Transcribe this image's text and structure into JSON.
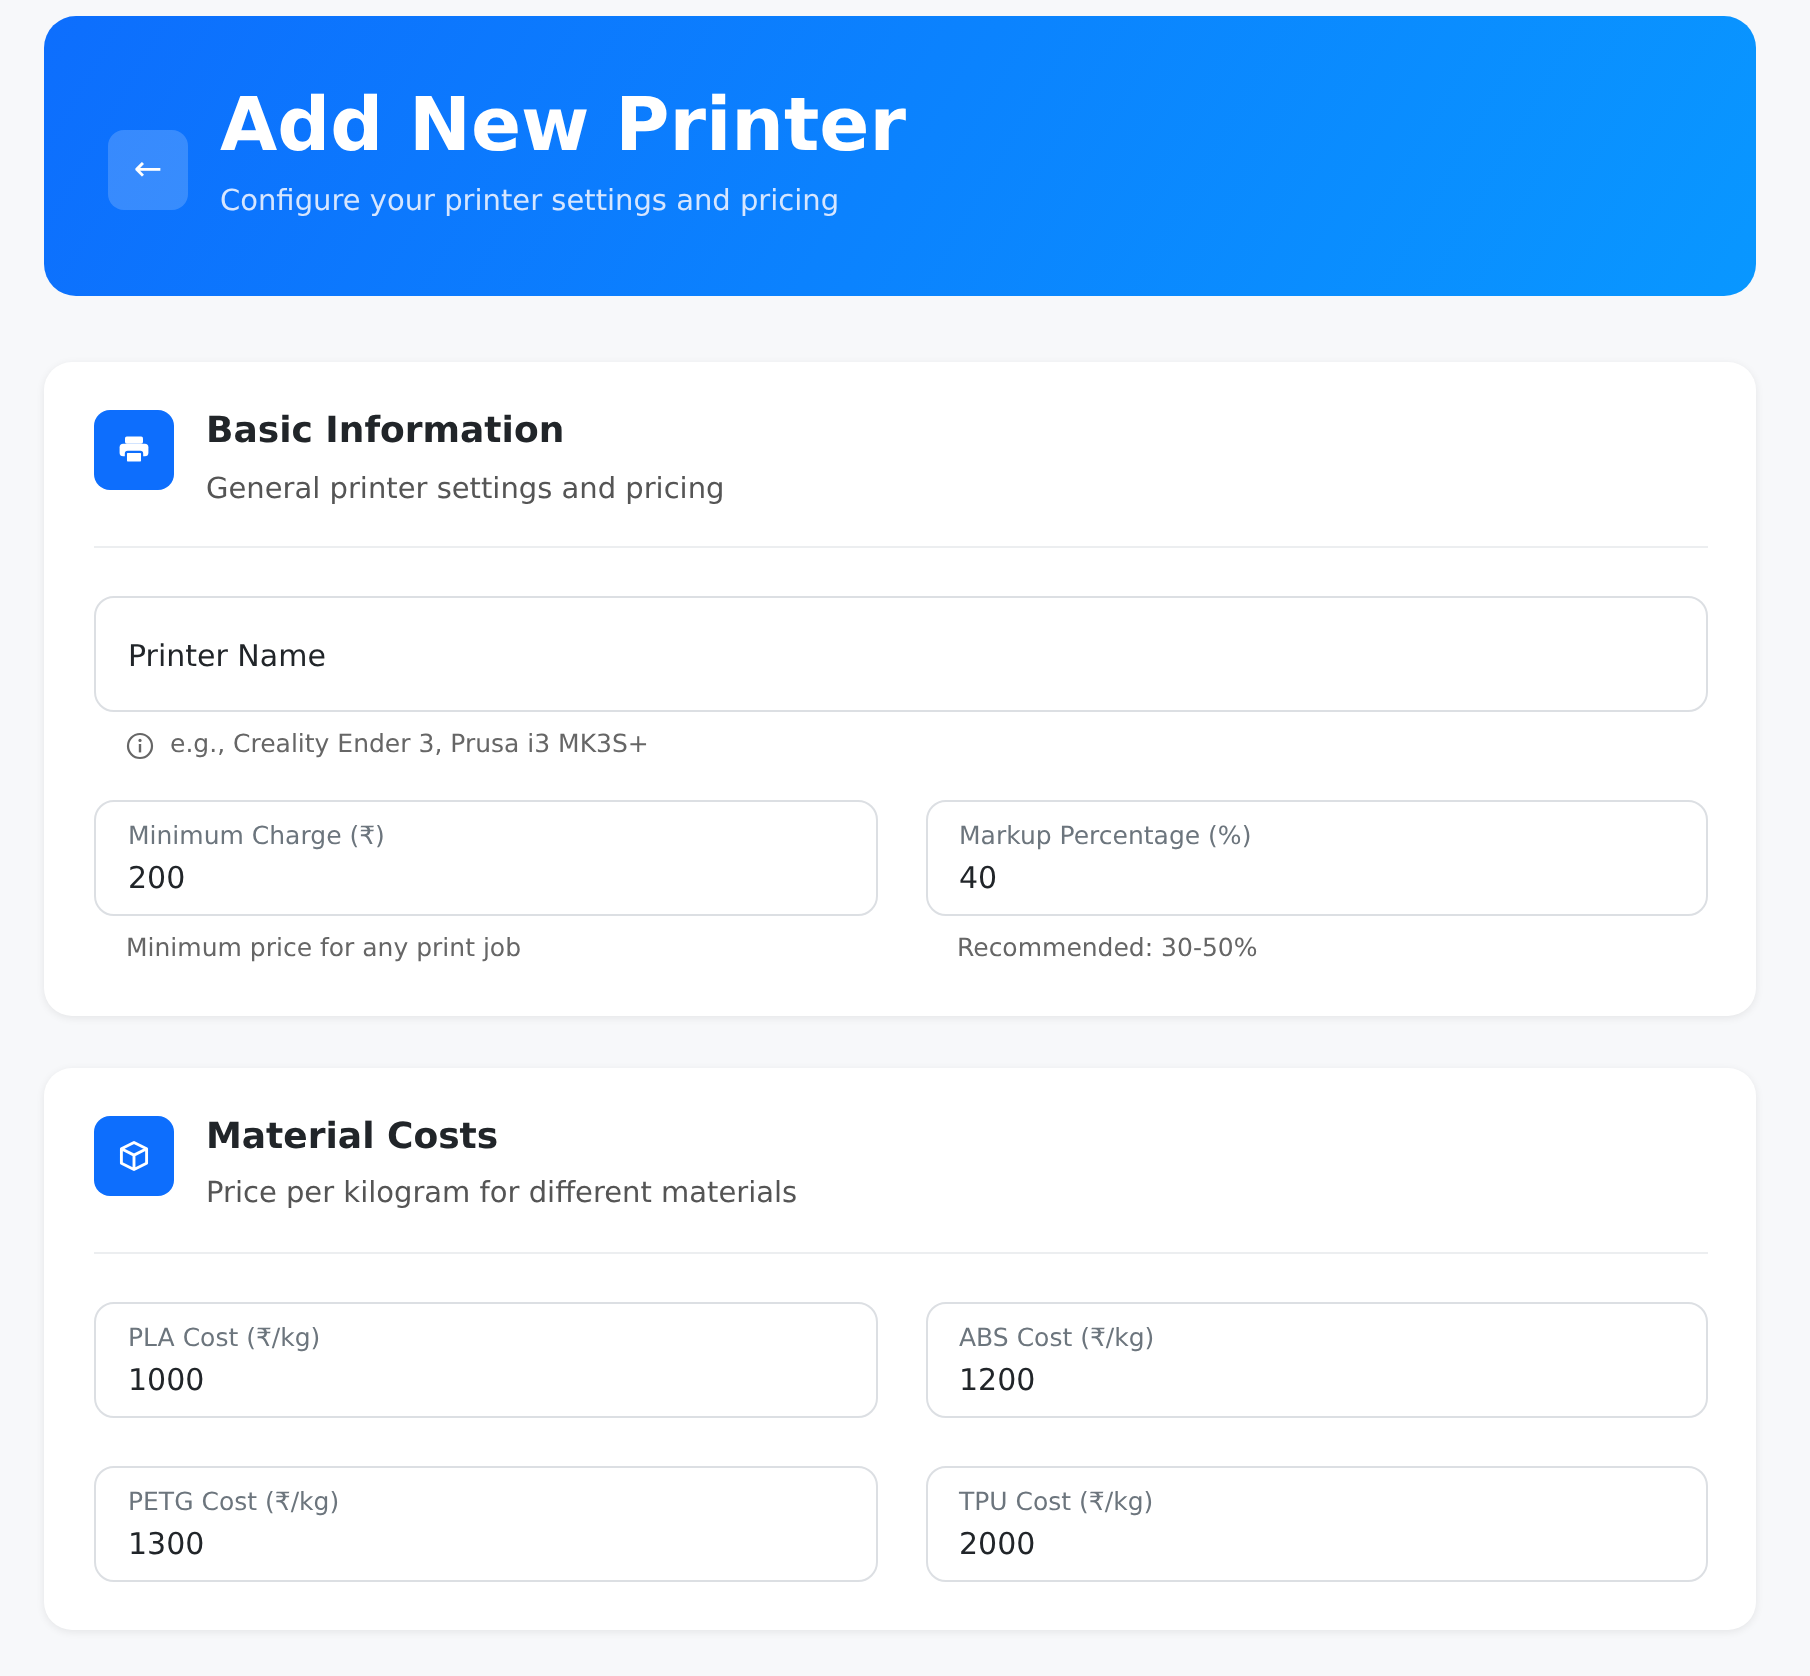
{
  "header": {
    "back_button": "←",
    "title": "Add New Printer",
    "subtitle": "Configure your printer settings and pricing"
  },
  "sections": [
    {
      "title": "Basic Information",
      "subtitle": "General printer settings and pricing",
      "fields": [
        {
          "kind": "wide",
          "label": "Printer Name",
          "hint": "e.g., Creality Ender 3, Prusa i3 MK3S+"
        },
        {
          "label": "Minimum Charge (₹)",
          "value": "200",
          "hint": "Minimum price for any print job"
        },
        {
          "label": "Markup Percentage (%)",
          "value": "40",
          "hint": "Recommended: 30-50%"
        }
      ]
    },
    {
      "title": "Material Costs",
      "subtitle": "Price per kilogram for different materials",
      "fields": [
        {
          "label": "PLA Cost (₹/kg)",
          "value": "1000"
        },
        {
          "label": "ABS Cost (₹/kg)",
          "value": "1200"
        },
        {
          "label": "PETG Cost (₹/kg)",
          "value": "1300"
        },
        {
          "label": "TPU Cost (₹/kg)",
          "value": "2000"
        }
      ]
    }
  ]
}
